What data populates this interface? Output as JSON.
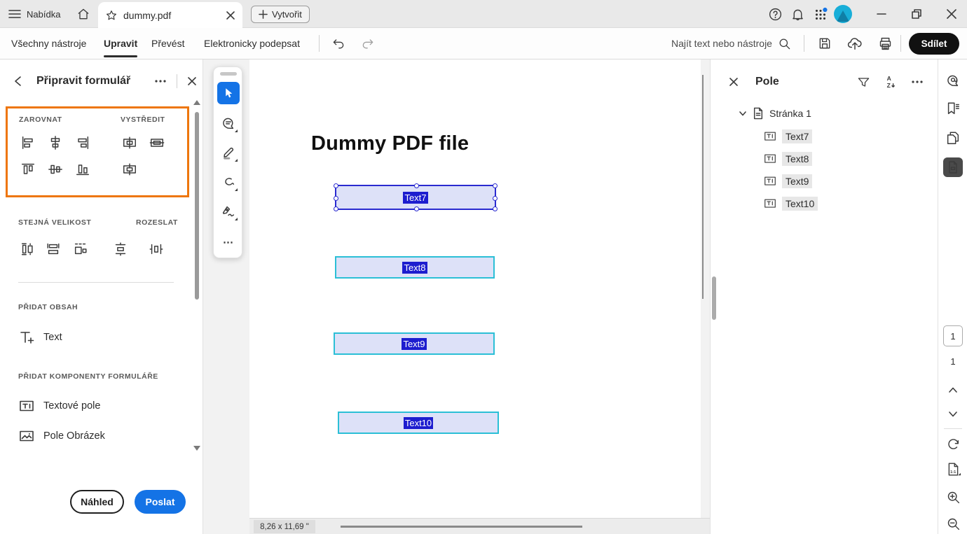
{
  "tabbar": {
    "menu_label": "Nabídka",
    "tab_title": "dummy.pdf",
    "create_label": "Vytvořit"
  },
  "toolbar": {
    "nav": [
      {
        "label": "Všechny nástroje"
      },
      {
        "label": "Upravit"
      },
      {
        "label": "Převést"
      },
      {
        "label": "Elektronicky podepsat"
      }
    ],
    "search_label": "Najít text nebo nástroje",
    "share_label": "Sdílet"
  },
  "left_panel": {
    "title": "Připravit formulář",
    "align_title": "ZAROVNAT",
    "center_title": "VYSTŘEDIT",
    "size_title": "STEJNÁ VELIKOST",
    "distribute_title": "ROZESLAT",
    "add_content_title": "PŘIDAT OBSAH",
    "add_components_title": "PŘIDAT KOMPONENTY FORMULÁŘE",
    "items": {
      "text": "Text",
      "text_field": "Textové pole",
      "image_field": "Pole Obrázek"
    },
    "buttons": {
      "preview": "Náhled",
      "send": "Poslat"
    }
  },
  "canvas": {
    "doc_heading": "Dummy PDF file",
    "fields": [
      {
        "label": "Text7",
        "state": "selected"
      },
      {
        "label": "Text8",
        "state": "normal"
      },
      {
        "label": "Text9",
        "state": "normal"
      },
      {
        "label": "Text10",
        "state": "normal"
      }
    ],
    "page_size_label": "8,26 x 11,69 \""
  },
  "fields_panel": {
    "title": "Pole",
    "page_group": "Stránka 1",
    "items": [
      {
        "label": "Text7"
      },
      {
        "label": "Text8"
      },
      {
        "label": "Text9"
      },
      {
        "label": "Text10"
      }
    ]
  },
  "right_rail": {
    "page_number": "1",
    "page_total": "1"
  },
  "colors": {
    "accent_blue": "#1473e6",
    "highlight_orange": "#ee760d",
    "field_border_cyan": "#2bbfd6",
    "field_border_selected": "#2a2ad0",
    "field_fill": "#dde1f8",
    "label_highlight": "#1d1dcf",
    "share_black": "#111111"
  }
}
